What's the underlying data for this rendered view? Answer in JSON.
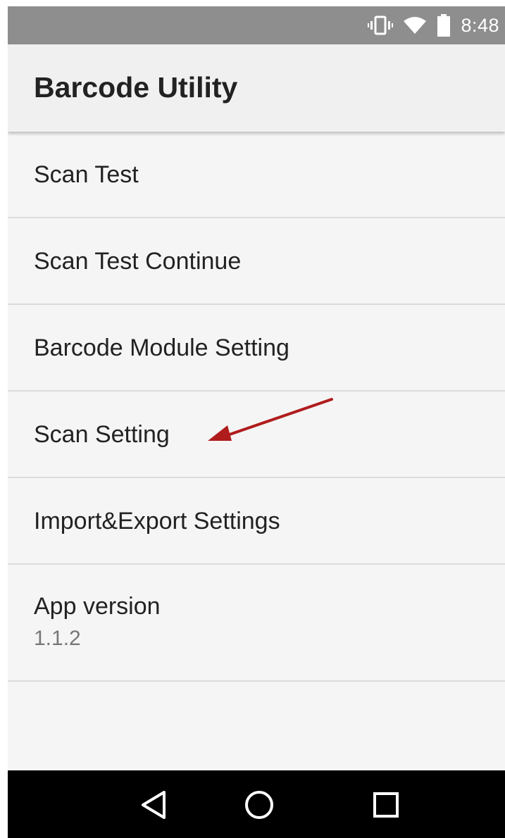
{
  "status_bar": {
    "time": "8:48",
    "icons": [
      "vibrate-icon",
      "wifi-icon",
      "battery-icon"
    ]
  },
  "app_bar": {
    "title": "Barcode Utility"
  },
  "menu": {
    "items": [
      {
        "label": "Scan Test"
      },
      {
        "label": "Scan Test Continue"
      },
      {
        "label": "Barcode Module Setting"
      },
      {
        "label": "Scan Setting"
      },
      {
        "label": "Import&Export Settings"
      }
    ],
    "version": {
      "label": "App version",
      "value": "1.1.2"
    }
  },
  "annotation": {
    "type": "arrow",
    "color": "#b01c1c",
    "points_to": "Scan Setting"
  },
  "nav_bar": {
    "icons": [
      "back-icon",
      "home-icon",
      "recents-icon"
    ]
  },
  "colors": {
    "status_bar": "#8e8e8e",
    "app_bar": "#f0f0f0",
    "background": "#f5f5f5",
    "divider": "#dcdcdc",
    "nav_bar": "#000000"
  }
}
